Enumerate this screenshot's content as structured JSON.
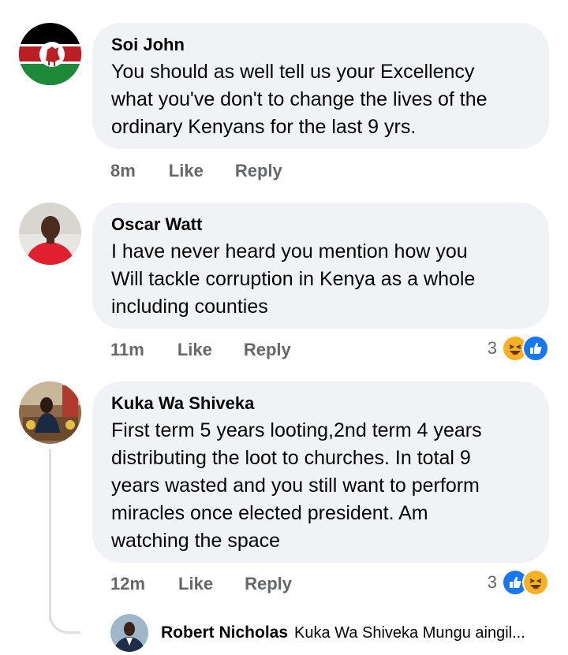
{
  "comments": [
    {
      "name": "Soi John",
      "text": "You should as well tell us your Excellency\nwhat you've don't to change the lives of the\nordinary Kenyans for the last 9 yrs.",
      "time": "8m",
      "like_label": "Like",
      "reply_label": "Reply"
    },
    {
      "name": "Oscar Watt",
      "text": "I have never heard you mention how you\nWill tackle corruption in Kenya as a whole\nincluding counties",
      "time": "11m",
      "like_label": "Like",
      "reply_label": "Reply",
      "reaction_count": "3",
      "reactions": [
        "haha-icon",
        "like-icon"
      ]
    },
    {
      "name": "Kuka Wa Shiveka",
      "text": "First term 5 years looting,2nd term 4 years\ndistributing the loot to churches. In total 9\nyears wasted and you still want to perform\nmiracles once elected president. Am\nwatching the space",
      "time": "12m",
      "like_label": "Like",
      "reply_label": "Reply",
      "reaction_count": "3",
      "reactions": [
        "like-icon",
        "haha-icon"
      ]
    }
  ],
  "reply_preview": {
    "name": "Robert Nicholas",
    "text": "Kuka Wa Shiveka Mungu aingil..."
  },
  "colors": {
    "bubble": "#f0f2f5",
    "meta_text": "#65676b",
    "like_blue": "#1877f2",
    "haha_yellow": "#f7b125"
  }
}
